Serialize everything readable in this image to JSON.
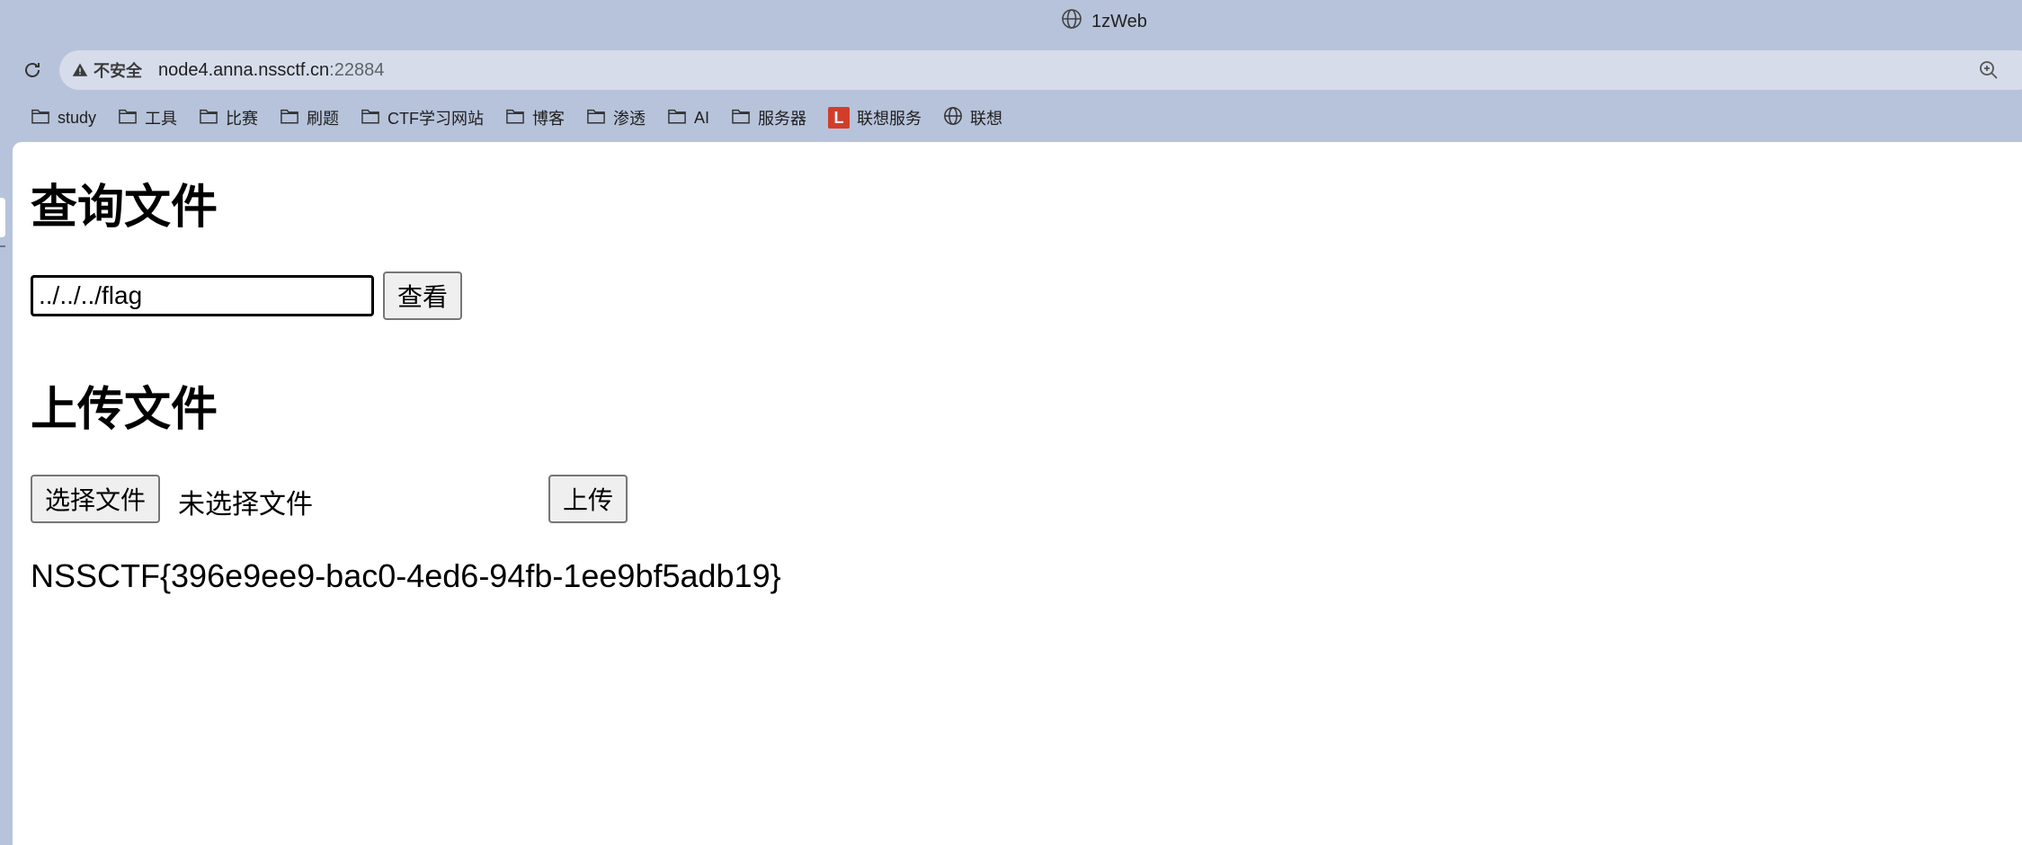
{
  "browser": {
    "tab_title": "1zWeb",
    "security_label": "不安全",
    "url_host": "node4.anna.nssctf.cn",
    "url_port": ":22884"
  },
  "bookmarks": [
    {
      "label": "study",
      "icon": "folder-icon"
    },
    {
      "label": "工具",
      "icon": "folder-icon"
    },
    {
      "label": "比赛",
      "icon": "folder-icon"
    },
    {
      "label": "刷题",
      "icon": "folder-icon"
    },
    {
      "label": "CTF学习网站",
      "icon": "folder-icon"
    },
    {
      "label": "博客",
      "icon": "folder-icon"
    },
    {
      "label": "渗透",
      "icon": "folder-icon"
    },
    {
      "label": "AI",
      "icon": "folder-icon"
    },
    {
      "label": "服务器",
      "icon": "folder-icon"
    },
    {
      "label": "联想服务",
      "icon": "lenovo-icon",
      "badge": "L"
    },
    {
      "label": "联想",
      "icon": "globe-icon"
    }
  ],
  "page": {
    "query_heading": "查询文件",
    "query_input_value": "../../../flag",
    "query_button": "查看",
    "upload_heading": "上传文件",
    "choose_file_button": "选择文件",
    "file_status": "未选择文件",
    "upload_button": "上传",
    "result_text": "NSSCTF{396e9ee9-bac0-4ed6-94fb-1ee9bf5adb19}"
  },
  "colors": {
    "chrome_bg": "#b7c3da",
    "omnibox_bg": "#d6dcea",
    "lenovo_red": "#d23d2b"
  }
}
